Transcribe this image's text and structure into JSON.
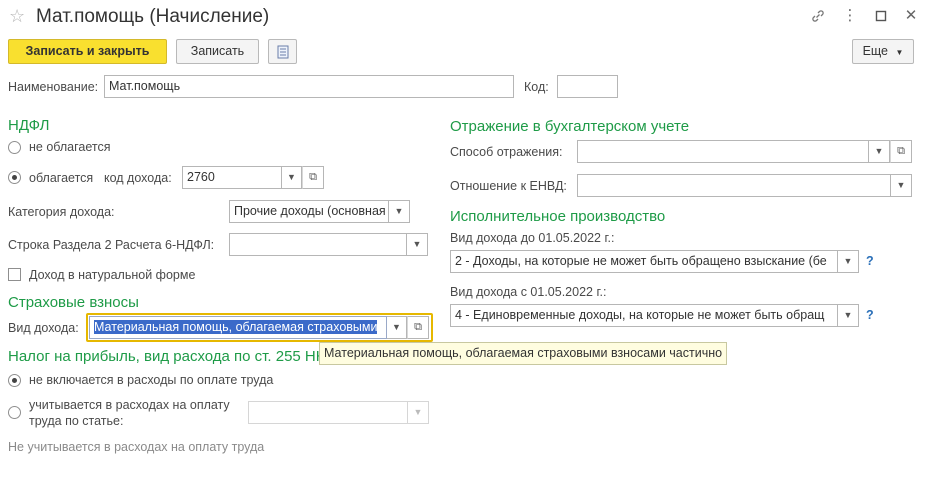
{
  "window": {
    "title": "Мат.помощь (Начисление)",
    "star_icon": "star-icon",
    "link_icon": "link-icon",
    "more_icon": "more-vertical-icon",
    "maximize_icon": "maximize-icon",
    "close_icon": "close-icon"
  },
  "toolbar": {
    "save_close_label": "Записать и закрыть",
    "save_label": "Записать",
    "doc_icon": "document-list-icon",
    "more_label": "Еще"
  },
  "header": {
    "name_label": "Наименование:",
    "name_value": "Мат.помощь",
    "code_label": "Код:",
    "code_value": ""
  },
  "ndfl": {
    "title": "НДФЛ",
    "not_taxed_label": "не облагается",
    "taxed_label": "облагается",
    "income_code_label": "код дохода:",
    "income_code_value": "2760",
    "category_label": "Категория дохода:",
    "category_value": "Прочие доходы (основная",
    "row6_label": "Строка Раздела 2 Расчета 6-НДФЛ:",
    "row6_value": "",
    "in_kind_label": "Доход в натуральной форме",
    "selected": "taxed",
    "in_kind_checked": false
  },
  "insurance": {
    "title": "Страховые взносы",
    "income_type_label": "Вид дохода:",
    "income_type_value": "Материальная помощь, облагаемая страховыми",
    "tooltip": "Материальная помощь, облагаемая страховыми взносами частично"
  },
  "profit_tax": {
    "title": "Налог на прибыль, вид расхода по ст. 255 НК",
    "not_included_label": "не включается в расходы по оплате труда",
    "included_label_line1": "учитывается в расходах на оплату",
    "included_label_line2": "труда по статье:",
    "article_value": "",
    "note": "Не учитывается в расходах на оплату труда",
    "selected": "not_included"
  },
  "accounting": {
    "title": "Отражение в бухгалтерском учете",
    "method_label": "Способ отражения:",
    "method_value": "",
    "envd_label": "Отношение к ЕНВД:",
    "envd_value": ""
  },
  "enforcement": {
    "title": "Исполнительное производство",
    "before_label": "Вид дохода до 01.05.2022 г.:",
    "before_value": "2 - Доходы, на которые не может быть обращено взыскание (бе",
    "after_label": "Вид дохода с 01.05.2022 г.:",
    "after_value": "4 - Единовременные доходы, на которые не может быть обращ",
    "help_label": "?"
  },
  "colors": {
    "accent_yellow": "#f9e02f",
    "section_green": "#1e9b47",
    "selection_blue": "#3b6ac9",
    "focus_border": "#e6b800"
  }
}
